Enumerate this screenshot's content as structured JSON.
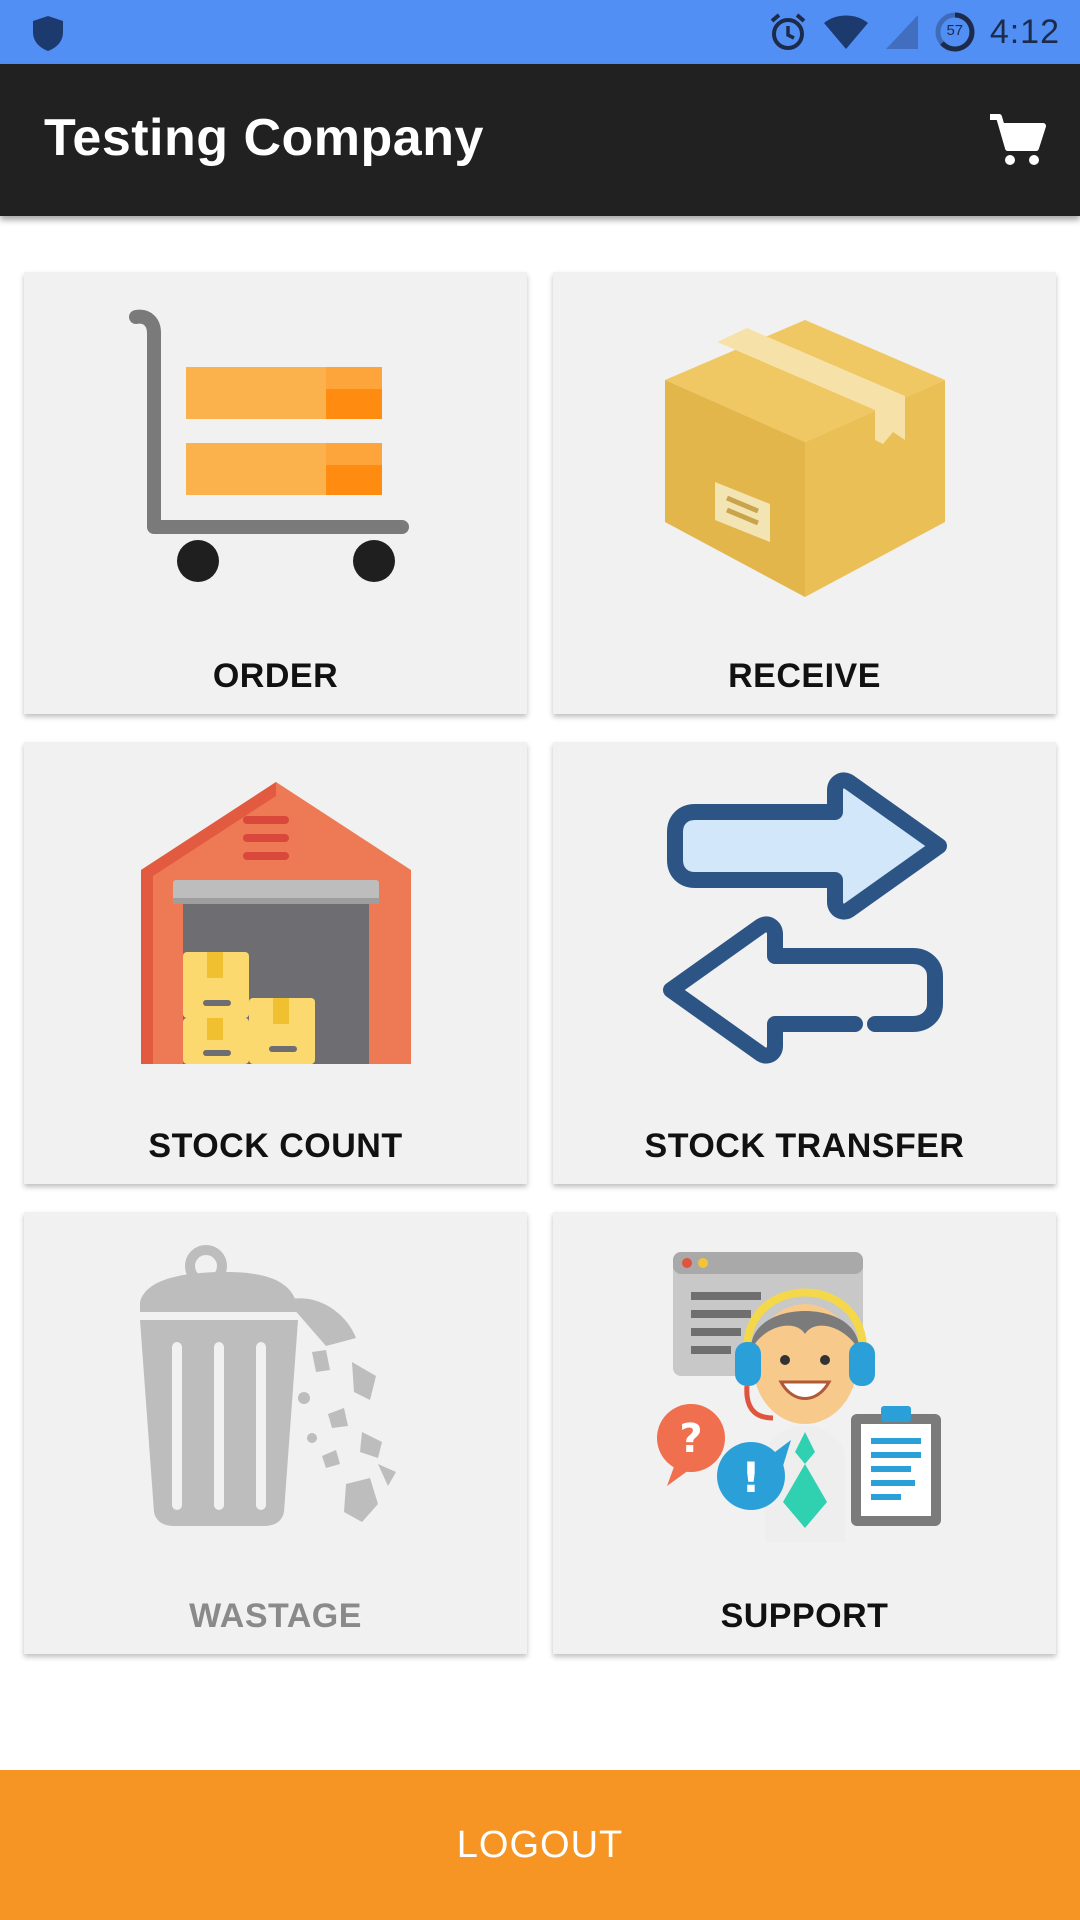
{
  "status_bar": {
    "icons": [
      "shield-icon",
      "alarm-icon",
      "wifi-icon",
      "signal-icon",
      "battery-icon"
    ],
    "battery_level": "57",
    "time": "4:12"
  },
  "app_bar": {
    "title": "Testing Company",
    "cart_icon": "cart-icon"
  },
  "tiles": [
    {
      "label": "ORDER",
      "icon": "trolley-icon",
      "enabled": true
    },
    {
      "label": "RECEIVE",
      "icon": "box-icon",
      "enabled": true
    },
    {
      "label": "STOCK COUNT",
      "icon": "warehouse-icon",
      "enabled": true
    },
    {
      "label": "STOCK TRANSFER",
      "icon": "transfer-arrows-icon",
      "enabled": true
    },
    {
      "label": "WASTAGE",
      "icon": "trash-icon",
      "enabled": false
    },
    {
      "label": "SUPPORT",
      "icon": "support-agent-icon",
      "enabled": true
    }
  ],
  "logout": {
    "label": "LOGOUT"
  },
  "colors": {
    "status_bar": "#528ff5",
    "app_bar": "#212121",
    "tile_bg": "#f1f1f1",
    "logout": "#f69523"
  }
}
